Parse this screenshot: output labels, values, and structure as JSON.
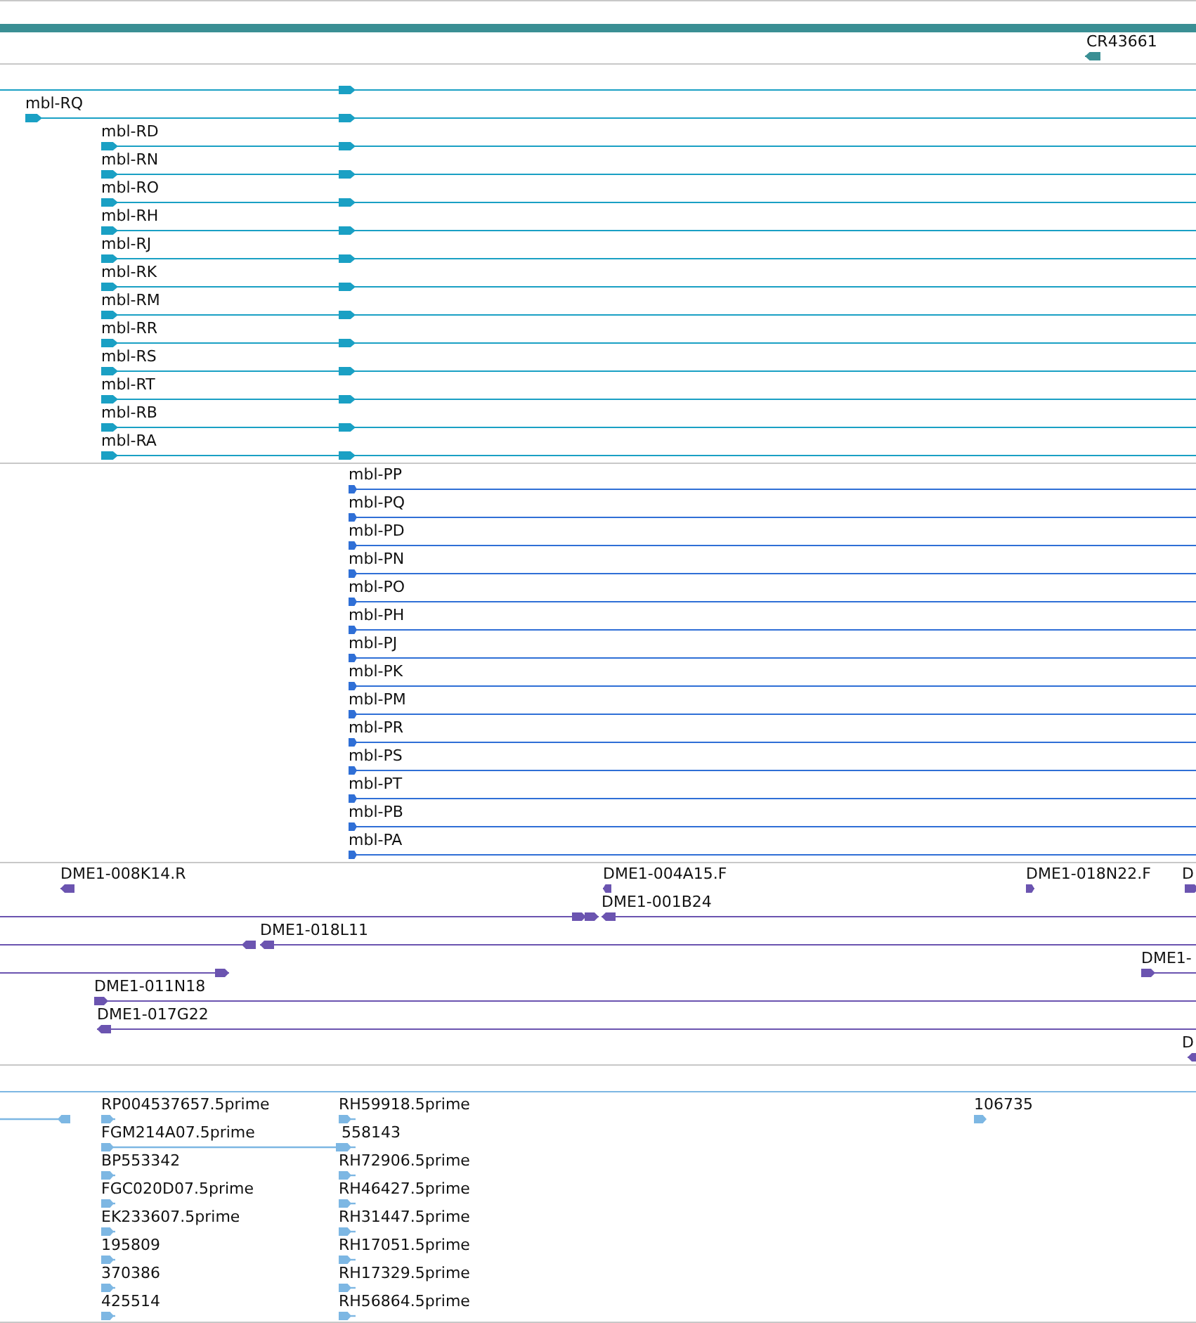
{
  "tracks": [
    {
      "kind": "bar",
      "color": "#3a8f94",
      "features": [
        {
          "label": "CR43661",
          "reverse": true
        }
      ]
    },
    {
      "kind": "transcript",
      "color": "#1aa0c4",
      "features": [
        {
          "reverse": false
        },
        {
          "label": "mbl-RQ",
          "reverse": false
        },
        {
          "label": "mbl-RD",
          "reverse": false
        },
        {
          "label": "mbl-RN",
          "reverse": false
        },
        {
          "label": "mbl-RO",
          "reverse": false
        },
        {
          "label": "mbl-RH",
          "reverse": false
        },
        {
          "label": "mbl-RJ",
          "reverse": false
        },
        {
          "label": "mbl-RK",
          "reverse": false
        },
        {
          "label": "mbl-RM",
          "reverse": false
        },
        {
          "label": "mbl-RR",
          "reverse": false
        },
        {
          "label": "mbl-RS",
          "reverse": false
        },
        {
          "label": "mbl-RT",
          "reverse": false
        },
        {
          "label": "mbl-RB",
          "reverse": false
        },
        {
          "label": "mbl-RA",
          "reverse": false
        }
      ]
    },
    {
      "kind": "protein",
      "color": "#2f6fd6",
      "features": [
        {
          "label": "mbl-PP",
          "reverse": false
        },
        {
          "label": "mbl-PQ",
          "reverse": false
        },
        {
          "label": "mbl-PD",
          "reverse": false
        },
        {
          "label": "mbl-PN",
          "reverse": false
        },
        {
          "label": "mbl-PO",
          "reverse": false
        },
        {
          "label": "mbl-PH",
          "reverse": false
        },
        {
          "label": "mbl-PJ",
          "reverse": false
        },
        {
          "label": "mbl-PK",
          "reverse": false
        },
        {
          "label": "mbl-PM",
          "reverse": false
        },
        {
          "label": "mbl-PR",
          "reverse": false
        },
        {
          "label": "mbl-PS",
          "reverse": false
        },
        {
          "label": "mbl-PT",
          "reverse": false
        },
        {
          "label": "mbl-PB",
          "reverse": false
        },
        {
          "label": "mbl-PA",
          "reverse": false
        }
      ]
    },
    {
      "kind": "clone",
      "color": "#6b54b0",
      "features": [
        {
          "label": "DME1-008K14.R",
          "reverse": true
        },
        {
          "label": "DME1-004A15.F",
          "reverse": true
        },
        {
          "label": "DME1-018N22.F",
          "reverse": false
        },
        {
          "label": "D",
          "reverse": false
        },
        {
          "reverse": false
        },
        {
          "label": "DME1-001B24",
          "reverse": true
        },
        {
          "reverse": true
        },
        {
          "label": "DME1-018L11",
          "reverse": true
        },
        {
          "reverse": false
        },
        {
          "label": "DME1-",
          "reverse": false
        },
        {
          "label": "DME1-011N18",
          "reverse": false
        },
        {
          "label": "DME1-017G22",
          "reverse": true
        },
        {
          "label": "D",
          "reverse": true
        }
      ]
    },
    {
      "kind": "est",
      "color": "#7db7e3",
      "features": [
        {
          "reverse": true
        },
        {
          "label": "RP004537657.5prime",
          "reverse": false
        },
        {
          "label": "FGM214A07.5prime",
          "reverse": false
        },
        {
          "label": "BP553342",
          "reverse": false
        },
        {
          "label": "FGC020D07.5prime",
          "reverse": false
        },
        {
          "label": "EK233607.5prime",
          "reverse": false
        },
        {
          "label": "195809",
          "reverse": false
        },
        {
          "label": "370386",
          "reverse": false
        },
        {
          "label": "425514",
          "reverse": false
        },
        {
          "label": "RH59918.5prime",
          "reverse": false
        },
        {
          "label": "558143",
          "reverse": false
        },
        {
          "label": "RH72906.5prime",
          "reverse": false
        },
        {
          "label": "RH46427.5prime",
          "reverse": false
        },
        {
          "label": "RH31447.5prime",
          "reverse": false
        },
        {
          "label": "RH17051.5prime",
          "reverse": false
        },
        {
          "label": "RH17329.5prime",
          "reverse": false
        },
        {
          "label": "RH56864.5prime",
          "reverse": false
        },
        {
          "label": "106735",
          "reverse": false
        }
      ]
    }
  ]
}
